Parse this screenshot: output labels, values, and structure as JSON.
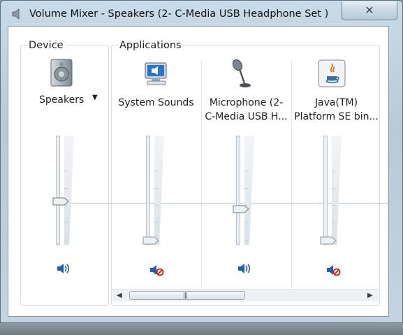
{
  "window": {
    "title": "Volume Mixer - Speakers (2- C-Media USB Headphone Set  )"
  },
  "device": {
    "group_label": "Device",
    "name": "Speakers",
    "level": 0.39,
    "muted": false
  },
  "applications": {
    "group_label": "Applications",
    "items": [
      {
        "name_lines": [
          "System Sounds"
        ],
        "level": 0.0,
        "muted": true,
        "icon": "system-sounds-icon"
      },
      {
        "name_lines": [
          "Microphone (2-",
          "C-Media USB H..."
        ],
        "level": 0.31,
        "muted": false,
        "icon": "microphone-icon"
      },
      {
        "name_lines": [
          "Java(TM)",
          "Platform SE bin..."
        ],
        "level": 0.0,
        "muted": true,
        "icon": "java-icon"
      }
    ]
  },
  "scrollbar": {
    "grip": "|||"
  },
  "colors": {
    "speaker_blue": "#1f5fb0",
    "mute_red": "#d01818"
  }
}
